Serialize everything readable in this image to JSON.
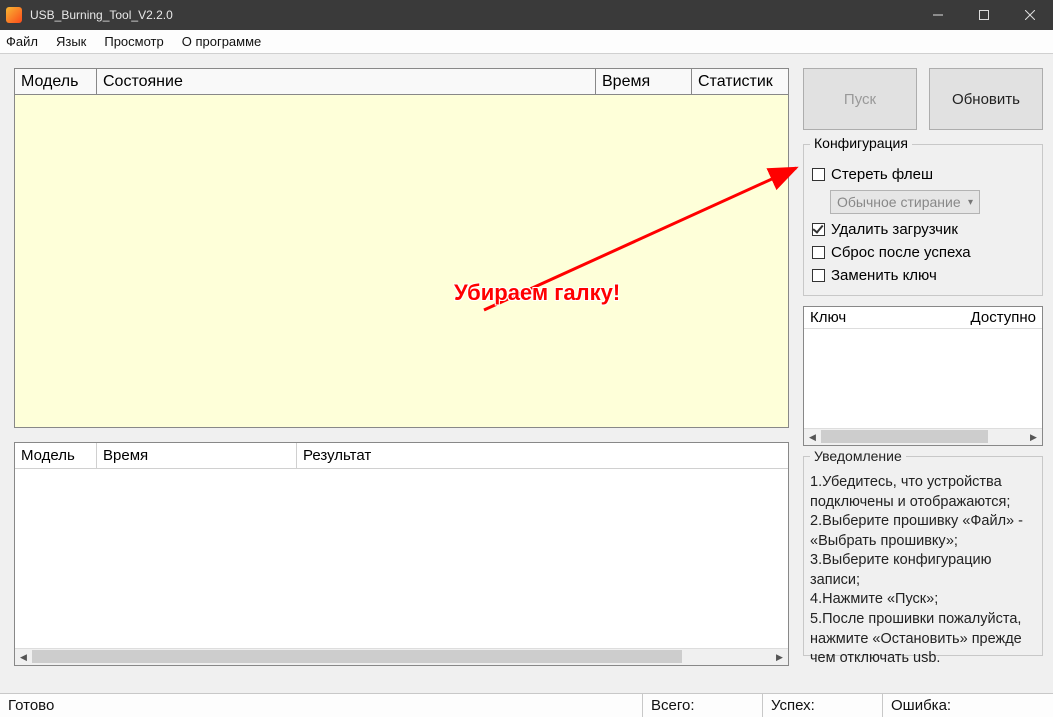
{
  "window": {
    "title": "USB_Burning_Tool_V2.2.0"
  },
  "menu": {
    "file": "Файл",
    "lang": "Язык",
    "view": "Просмотр",
    "about": "О программе"
  },
  "grid_top": {
    "col_model": "Модель",
    "col_state": "Состояние",
    "col_time": "Время",
    "col_stat": "Статистик"
  },
  "grid_bottom": {
    "col_model": "Модель",
    "col_time": "Время",
    "col_result": "Результат"
  },
  "buttons": {
    "start": "Пуск",
    "refresh": "Обновить"
  },
  "config": {
    "title": "Конфигурация",
    "erase_flash": "Стереть флеш",
    "erase_mode": "Обычное стирание",
    "erase_bootloader": "Удалить загрузчик",
    "reset_after": "Сброс после успеха",
    "replace_key": "Заменить ключ"
  },
  "keybox": {
    "col_key": "Ключ",
    "col_avail": "Доступно"
  },
  "notice": {
    "title": "Уведомление",
    "l1": "1.Убедитесь, что устройства подключены и отображаются;",
    "l2": "2.Выберите прошивку «Файл» - «Выбрать прошивку»;",
    "l3": "3.Выберите конфигурацию записи;",
    "l4": "4.Нажмите «Пуск»;",
    "l5": "5.После прошивки пожалуйста, нажмите «Остановить» прежде чем отключать usb."
  },
  "status": {
    "ready": "Готово",
    "total": "Всего:",
    "success": "Успех:",
    "error": "Ошибка:"
  },
  "annotation": {
    "text": "Убираем галку!"
  }
}
